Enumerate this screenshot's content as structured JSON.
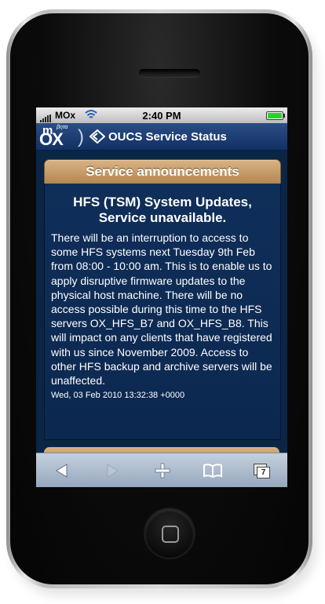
{
  "status_bar": {
    "carrier": "MOx",
    "time": "2:40 PM",
    "signal_icon": "signal-bars-icon",
    "wifi_icon": "wifi-icon",
    "battery_icon": "battery-icon"
  },
  "header": {
    "logo_m": "m",
    "logo_beta": "βητα",
    "logo_ox": "OX",
    "logo_bracket": ")",
    "title": "OUCS Service Status"
  },
  "section": {
    "title": "Service announcements"
  },
  "announcement": {
    "title": "HFS (TSM) System Updates, Service unavailable.",
    "body": "There will be an interruption to access to some HFS systems next Tuesday 9th Feb from 08:00 - 10:00 am. This is to enable us to apply disruptive firmware updates to the physical host machine. There will be no access possible during this time to the HFS servers OX_HFS_B7 and OX_HFS_B8. This will impact on any clients that have registered with us since November 2009. Access to other HFS backup and archive servers will be unaffected.",
    "date": "Wed, 03 Feb 2010 13:32:38 +0000"
  },
  "toolbar": {
    "back_icon": "back-arrow-icon",
    "forward_icon": "forward-arrow-icon",
    "add_icon": "plus-icon",
    "bookmarks_icon": "open-book-icon",
    "pages_icon": "pages-icon",
    "pages_count": "7"
  },
  "colors": {
    "header_bg": "#1f3f72",
    "content_bg": "#0c2850",
    "section_bar": "#c79b68",
    "toolbar": "#aab8c9"
  }
}
